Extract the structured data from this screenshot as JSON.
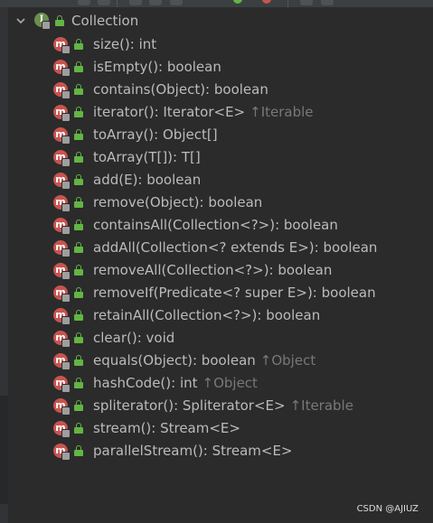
{
  "tree": {
    "root": {
      "label": "Collection",
      "icon": "interface-icon",
      "expanded": true
    },
    "methods": [
      {
        "name": "size(): int",
        "inherited": ""
      },
      {
        "name": "isEmpty(): boolean",
        "inherited": ""
      },
      {
        "name": "contains(Object): boolean",
        "inherited": ""
      },
      {
        "name": "iterator(): Iterator<E>",
        "inherited": "↑Iterable"
      },
      {
        "name": "toArray(): Object[]",
        "inherited": ""
      },
      {
        "name": "toArray(T[]): T[]",
        "inherited": ""
      },
      {
        "name": "add(E): boolean",
        "inherited": ""
      },
      {
        "name": "remove(Object): boolean",
        "inherited": ""
      },
      {
        "name": "containsAll(Collection<?>): boolean",
        "inherited": ""
      },
      {
        "name": "addAll(Collection<? extends E>): boolean",
        "inherited": ""
      },
      {
        "name": "removeAll(Collection<?>): boolean",
        "inherited": ""
      },
      {
        "name": "removeIf(Predicate<? super E>): boolean",
        "inherited": ""
      },
      {
        "name": "retainAll(Collection<?>): boolean",
        "inherited": ""
      },
      {
        "name": "clear(): void",
        "inherited": ""
      },
      {
        "name": "equals(Object): boolean",
        "inherited": "↑Object"
      },
      {
        "name": "hashCode(): int",
        "inherited": "↑Object"
      },
      {
        "name": "spliterator(): Spliterator<E>",
        "inherited": "↑Iterable"
      },
      {
        "name": "stream(): Stream<E>",
        "inherited": ""
      },
      {
        "name": "parallelStream(): Stream<E>",
        "inherited": ""
      }
    ],
    "method_icon_letter": "m",
    "interface_icon_letter": "I"
  },
  "watermark": "CSDN @AJIUZ",
  "colors": {
    "background": "#2b2b2b",
    "text": "#bbbbbb",
    "inherited_text": "#787878",
    "method_icon": "#c75450",
    "interface_icon": "#6a8f4e",
    "public_lock": "#62b543"
  }
}
